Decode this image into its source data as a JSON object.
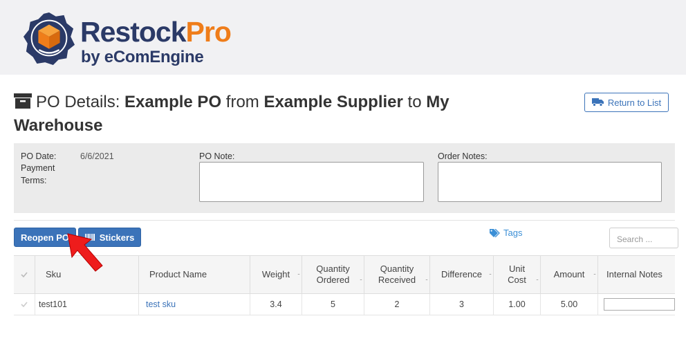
{
  "brand": {
    "name_part1": "Restock",
    "name_part2": "Pro",
    "subtitle": "by eComEngine",
    "primary_color": "#2b3a67",
    "accent_color": "#ef7d1a"
  },
  "page": {
    "title_prefix": "PO Details:",
    "po_name": "Example PO",
    "from_word": "from",
    "supplier": "Example Supplier",
    "to_word": "to",
    "destination": "My Warehouse",
    "icon": "archive-box-icon"
  },
  "return_button": {
    "label": "Return to List",
    "icon": "truck-icon"
  },
  "info": {
    "po_date_label": "PO Date:",
    "po_date_value": "6/6/2021",
    "payment_terms_label": "Payment Terms:",
    "po_note_label": "PO Note:",
    "po_note_value": "",
    "order_notes_label": "Order Notes:",
    "order_notes_value": ""
  },
  "toolbar": {
    "reopen_label": "Reopen PO",
    "stickers_label": "Stickers",
    "stickers_icon": "barcode-icon",
    "tags_label": "Tags",
    "tags_icon": "tags-icon",
    "search_placeholder": "Search ..."
  },
  "table": {
    "columns": [
      "",
      "Sku",
      "Product Name",
      "Weight",
      "Quantity Ordered",
      "Quantity Received",
      "Difference",
      "Unit Cost",
      "Amount",
      "Internal Notes"
    ],
    "rows": [
      {
        "sku": "test101",
        "product_name": "test sku",
        "weight": "3.4",
        "qty_ordered": "5",
        "qty_received": "2",
        "difference": "3",
        "unit_cost": "1.00",
        "amount": "5.00",
        "internal_notes": ""
      }
    ]
  }
}
